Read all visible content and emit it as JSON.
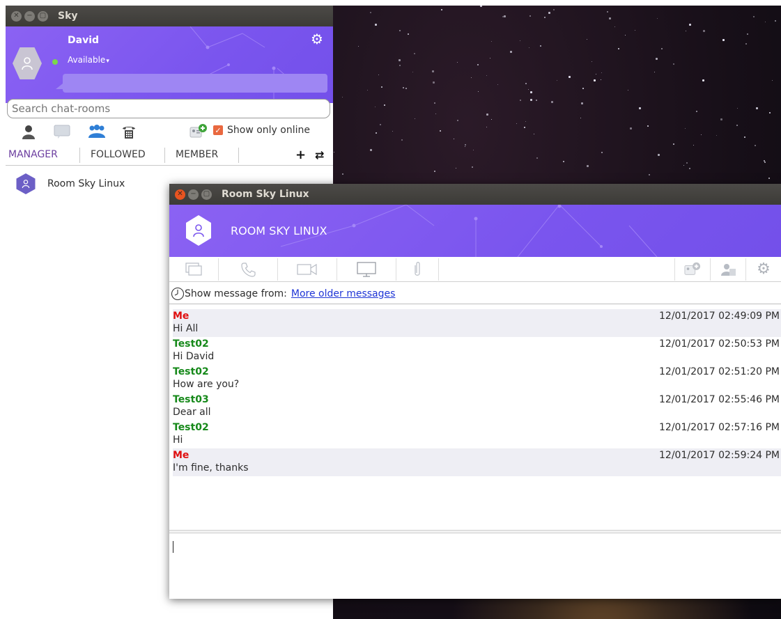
{
  "main_window": {
    "title": "Sky",
    "profile": {
      "name": "David",
      "status": "Available",
      "status_color": "#7ad84b"
    },
    "search": {
      "placeholder": "Search chat-rooms"
    },
    "filters": {
      "icons": [
        "contact-icon",
        "chat-icon",
        "group-icon",
        "phone-icon",
        "add-contact-icon"
      ],
      "show_only_online_label": "Show only online",
      "show_only_online_checked": true
    },
    "tabs": [
      {
        "label": "MANAGER",
        "active": true
      },
      {
        "label": "FOLLOWED",
        "active": false
      },
      {
        "label": "MEMBER",
        "active": false
      }
    ],
    "tab_actions": {
      "add": "+",
      "refresh": "⇄"
    },
    "rooms": [
      {
        "name": "Room Sky Linux"
      }
    ]
  },
  "chat_window": {
    "title": "Room Sky Linux",
    "room_title": "ROOM SKY LINUX",
    "toolbar": {
      "left_icons": [
        "chat-icon",
        "phone-icon",
        "video-icon",
        "screen-share-icon",
        "attachment-icon"
      ],
      "right_icons": [
        "add-contact-icon",
        "members-icon",
        "gear-icon"
      ]
    },
    "history": {
      "label": "Show message from:",
      "link": "More older messages"
    },
    "messages": [
      {
        "sender": "Me",
        "is_me": true,
        "time": "12/01/2017 02:49:09 PM",
        "text": "Hi All"
      },
      {
        "sender": "Test02",
        "is_me": false,
        "time": "12/01/2017 02:50:53 PM",
        "text": "Hi David"
      },
      {
        "sender": "Test02",
        "is_me": false,
        "time": "12/01/2017 02:51:20 PM",
        "text": "How are you?"
      },
      {
        "sender": "Test03",
        "is_me": false,
        "time": "12/01/2017 02:55:46 PM",
        "text": "Dear all"
      },
      {
        "sender": "Test02",
        "is_me": false,
        "time": "12/01/2017 02:57:16 PM",
        "text": "Hi"
      },
      {
        "sender": "Me",
        "is_me": true,
        "time": "12/01/2017 02:59:24 PM",
        "text": "I'm fine, thanks"
      }
    ],
    "compose": {
      "value": ""
    }
  },
  "colors": {
    "accent": "#7a55ee",
    "me_sender": "#e01010",
    "other_sender": "#16891a",
    "link": "#1f35d6",
    "titlebar": "#3c3b37",
    "close_button": "#e95420"
  }
}
